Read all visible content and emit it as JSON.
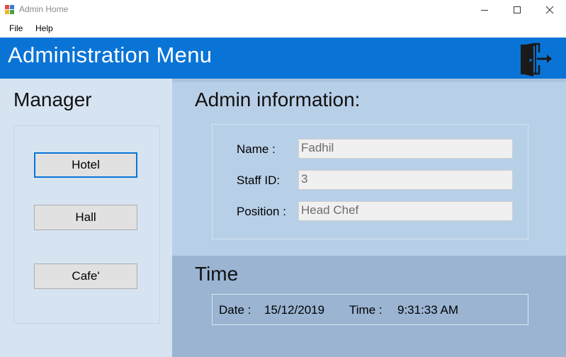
{
  "window": {
    "title": "Admin Home",
    "icon": "app-icon",
    "controls": {
      "minimize": "minimize-icon",
      "maximize": "maximize-icon",
      "close": "✕"
    }
  },
  "menu": {
    "file": "File",
    "help": "Help"
  },
  "header": {
    "title": "Administration Menu",
    "logout_icon": "exit-door-icon",
    "color": "#0a74d6"
  },
  "sidebar": {
    "title": "Manager",
    "buttons": {
      "hotel": "Hotel",
      "hall": "Hall",
      "cafe": "Cafe'"
    }
  },
  "admin_info": {
    "title": "Admin information:",
    "name_label": "Name :",
    "name_value": "Fadhil",
    "staff_label": "Staff ID:",
    "staff_value": "3",
    "position_label": "Position :",
    "position_value": "Head Chef"
  },
  "time": {
    "title": "Time",
    "date_label": "Date :",
    "date_value": "15/12/2019",
    "time_label": "Time :",
    "time_value": "9:31:33 AM"
  }
}
